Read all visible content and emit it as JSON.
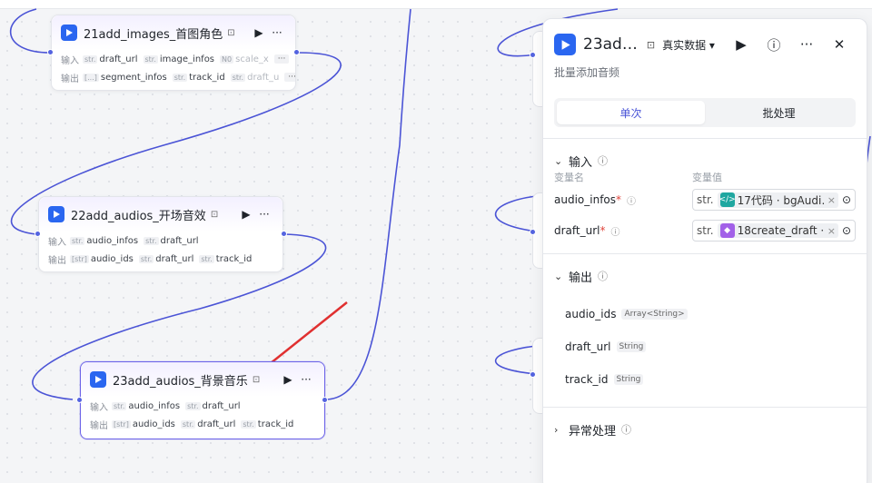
{
  "nodes": [
    {
      "id": "node21",
      "title": "21add_images_首图角色",
      "inputs_label": "输入",
      "outputs_label": "输出",
      "inputs": [
        {
          "type": "str.",
          "name": "draft_url"
        },
        {
          "type": "str.",
          "name": "image_infos"
        },
        {
          "type": "N0",
          "name": "scale_x"
        }
      ],
      "outputs": [
        {
          "type": "[...]",
          "name": "segment_infos"
        },
        {
          "type": "str.",
          "name": "track_id"
        },
        {
          "type": "str.",
          "name": "draft_u"
        }
      ],
      "more": "···"
    },
    {
      "id": "node22",
      "title": "22add_audios_开场音效",
      "inputs_label": "输入",
      "outputs_label": "输出",
      "inputs": [
        {
          "type": "str.",
          "name": "audio_infos"
        },
        {
          "type": "str.",
          "name": "draft_url"
        }
      ],
      "outputs": [
        {
          "type": "[str]",
          "name": "audio_ids"
        },
        {
          "type": "str.",
          "name": "draft_url"
        },
        {
          "type": "str.",
          "name": "track_id"
        }
      ]
    },
    {
      "id": "node23",
      "title": "23add_audios_背景音乐",
      "inputs_label": "输入",
      "outputs_label": "输出",
      "inputs": [
        {
          "type": "str.",
          "name": "audio_infos"
        },
        {
          "type": "str.",
          "name": "draft_url"
        }
      ],
      "outputs": [
        {
          "type": "[str]",
          "name": "audio_ids"
        },
        {
          "type": "str.",
          "name": "draft_url"
        },
        {
          "type": "str.",
          "name": "track_id"
        }
      ]
    }
  ],
  "panel": {
    "title": "23ad…",
    "data_mode": "真实数据",
    "description": "批量添加音频",
    "tabs": [
      "单次",
      "批处理"
    ],
    "active_tab": "单次",
    "input_section": {
      "title": "输入",
      "col_name": "变量名",
      "col_value": "变量值",
      "rows": [
        {
          "name": "audio_infos",
          "type": "str.",
          "ref_text": "17代码 · bgAudi…",
          "ref_color": "#1fa7a0"
        },
        {
          "name": "draft_url",
          "type": "str.",
          "ref_text": "18create_draft · d",
          "ref_color": "#a261e8"
        }
      ]
    },
    "output_section": {
      "title": "输出",
      "rows": [
        {
          "name": "audio_ids",
          "type": "Array<String>"
        },
        {
          "name": "draft_url",
          "type": "String"
        },
        {
          "name": "track_id",
          "type": "String"
        }
      ]
    },
    "error_section": {
      "title": "异常处理"
    }
  },
  "colors": {
    "accent": "#4a55d8",
    "wire": "#4b54d6",
    "brand": "#2a66f0",
    "arrow": "#e03030"
  }
}
